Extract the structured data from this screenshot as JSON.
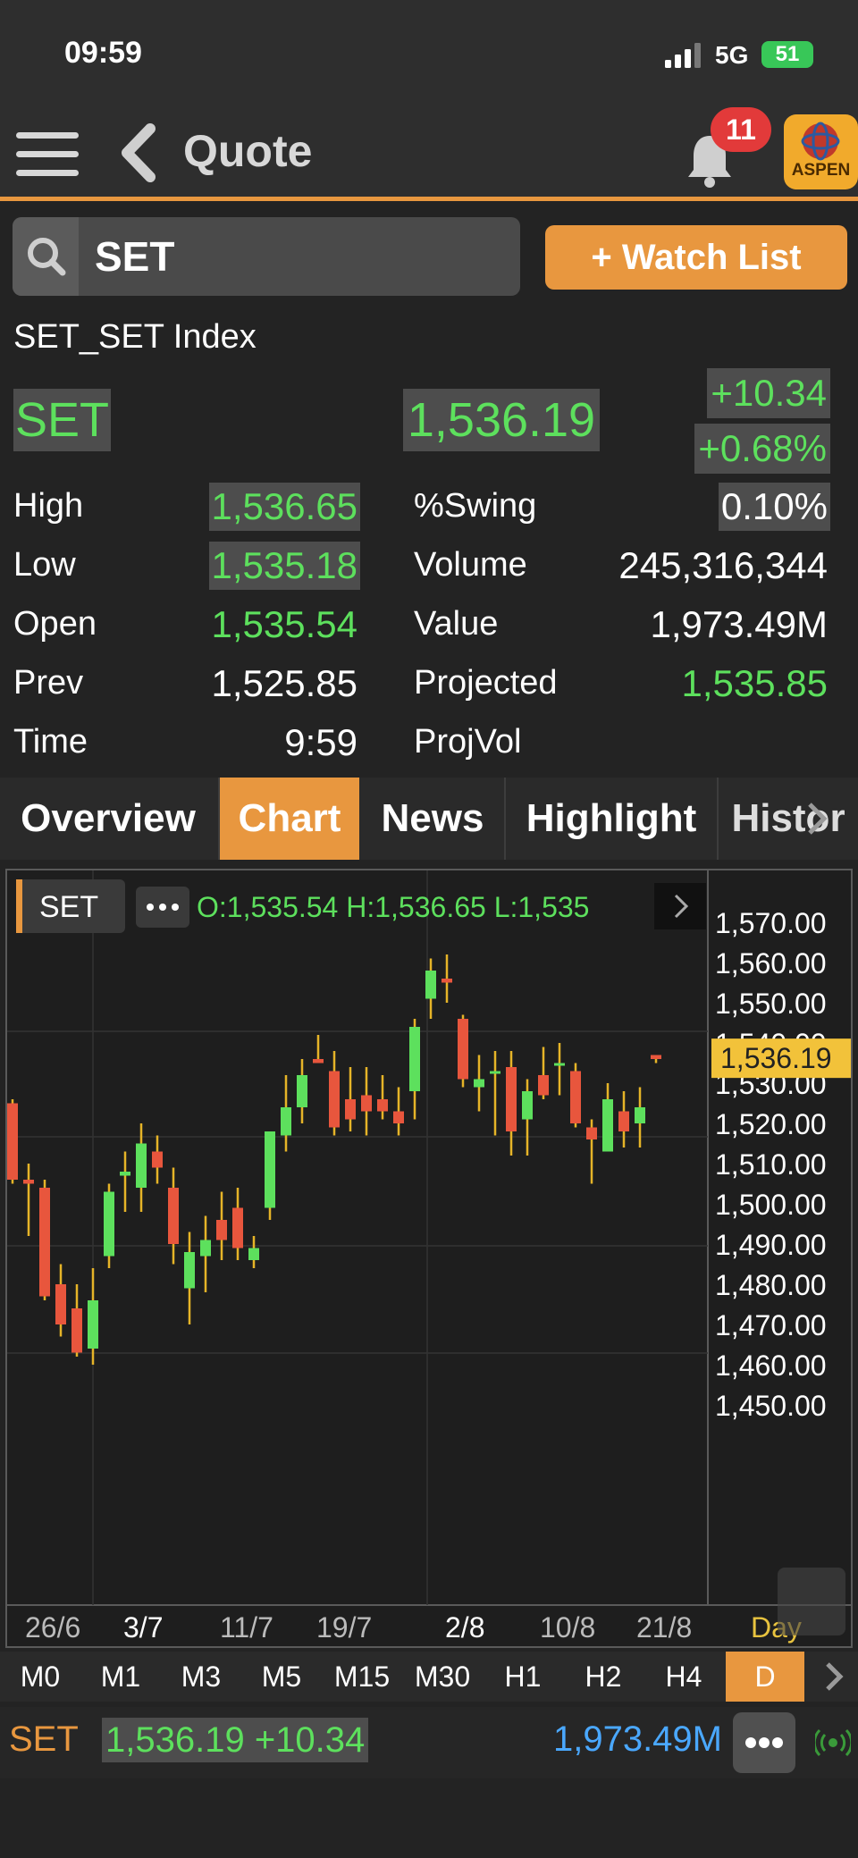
{
  "status": {
    "time": "09:59",
    "network": "5G",
    "battery": "51"
  },
  "header": {
    "title": "Quote",
    "notifications": "11",
    "brand": "ASPEN"
  },
  "search": {
    "value": "SET",
    "watch_label": "+ Watch List"
  },
  "quote": {
    "name": "SET_SET Index",
    "symbol": "SET",
    "last": "1,536.19",
    "change": "+10.34",
    "change_pct": "+0.68%",
    "high_label": "High",
    "high": "1,536.65",
    "low_label": "Low",
    "low": "1,535.18",
    "open_label": "Open",
    "open": "1,535.54",
    "prev_label": "Prev",
    "prev": "1,525.85",
    "time_label": "Time",
    "time": "9:59",
    "swing_label": "%Swing",
    "swing": "0.10%",
    "volume_label": "Volume",
    "volume": "245,316,344",
    "value_label": "Value",
    "value": "1,973.49M",
    "projected_label": "Projected",
    "projected": "1,535.85",
    "projvol_label": "ProjVol",
    "projvol": ""
  },
  "tabs": [
    "Overview",
    "Chart",
    "News",
    "Highlight",
    "Histor"
  ],
  "active_tab": "Chart",
  "chart_header": {
    "symbol": "SET",
    "ohlc": "O:1,535.54  H:1,536.65  L:1,535"
  },
  "timeframes": [
    "M0",
    "M1",
    "M3",
    "M5",
    "M15",
    "M30",
    "H1",
    "H2",
    "H4",
    "D"
  ],
  "active_timeframe": "D",
  "bottom": {
    "symbol": "SET",
    "price_change": "1,536.19 +10.34",
    "value": "1,973.49M"
  },
  "colors": {
    "accent": "#e8973f",
    "up": "#5de05d",
    "down": "#e8563d",
    "value_blue": "#4aa8ff"
  },
  "chart_data": {
    "type": "candlestick",
    "ylim": [
      1445,
      1575
    ],
    "y_ticks": [
      "1,570.00",
      "1,560.00",
      "1,550.00",
      "1,540.00",
      "1,530.00",
      "1,520.00",
      "1,510.00",
      "1,500.00",
      "1,490.00",
      "1,480.00",
      "1,470.00",
      "1,460.00",
      "1,450.00"
    ],
    "x_ticks": [
      "26/6",
      "3/7",
      "11/7",
      "19/7",
      "2/8",
      "10/8",
      "21/8"
    ],
    "period_label": "Day",
    "last_price_label": "1,536.19",
    "last_price": 1536.19,
    "candles": [
      {
        "o": 1525,
        "h": 1526,
        "l": 1505,
        "c": 1506
      },
      {
        "o": 1506,
        "h": 1510,
        "l": 1492,
        "c": 1505
      },
      {
        "o": 1504,
        "h": 1506,
        "l": 1476,
        "c": 1477
      },
      {
        "o": 1480,
        "h": 1485,
        "l": 1467,
        "c": 1470
      },
      {
        "o": 1474,
        "h": 1480,
        "l": 1462,
        "c": 1463
      },
      {
        "o": 1464,
        "h": 1484,
        "l": 1460,
        "c": 1476
      },
      {
        "o": 1487,
        "h": 1505,
        "l": 1484,
        "c": 1503
      },
      {
        "o": 1507,
        "h": 1513,
        "l": 1498,
        "c": 1508
      },
      {
        "o": 1504,
        "h": 1520,
        "l": 1498,
        "c": 1515
      },
      {
        "o": 1513,
        "h": 1517,
        "l": 1505,
        "c": 1509
      },
      {
        "o": 1504,
        "h": 1509,
        "l": 1485,
        "c": 1490
      },
      {
        "o": 1479,
        "h": 1493,
        "l": 1470,
        "c": 1488
      },
      {
        "o": 1487,
        "h": 1497,
        "l": 1478,
        "c": 1491
      },
      {
        "o": 1496,
        "h": 1503,
        "l": 1486,
        "c": 1491
      },
      {
        "o": 1499,
        "h": 1504,
        "l": 1486,
        "c": 1489
      },
      {
        "o": 1486,
        "h": 1492,
        "l": 1484,
        "c": 1489
      },
      {
        "o": 1499,
        "h": 1518,
        "l": 1496,
        "c": 1518
      },
      {
        "o": 1517,
        "h": 1532,
        "l": 1513,
        "c": 1524
      },
      {
        "o": 1524,
        "h": 1536,
        "l": 1520,
        "c": 1532
      },
      {
        "o": 1536,
        "h": 1542,
        "l": 1535,
        "c": 1535
      },
      {
        "o": 1533,
        "h": 1538,
        "l": 1517,
        "c": 1519
      },
      {
        "o": 1526,
        "h": 1534,
        "l": 1518,
        "c": 1521
      },
      {
        "o": 1527,
        "h": 1534,
        "l": 1517,
        "c": 1523
      },
      {
        "o": 1526,
        "h": 1532,
        "l": 1521,
        "c": 1523
      },
      {
        "o": 1523,
        "h": 1529,
        "l": 1517,
        "c": 1520
      },
      {
        "o": 1528,
        "h": 1546,
        "l": 1521,
        "c": 1544
      },
      {
        "o": 1551,
        "h": 1561,
        "l": 1546,
        "c": 1558
      },
      {
        "o": 1556,
        "h": 1562,
        "l": 1550,
        "c": 1555
      },
      {
        "o": 1546,
        "h": 1547,
        "l": 1529,
        "c": 1531
      },
      {
        "o": 1529,
        "h": 1537,
        "l": 1523,
        "c": 1531
      },
      {
        "o": 1533,
        "h": 1538,
        "l": 1517,
        "c": 1533
      },
      {
        "o": 1534,
        "h": 1538,
        "l": 1512,
        "c": 1518
      },
      {
        "o": 1521,
        "h": 1531,
        "l": 1512,
        "c": 1528
      },
      {
        "o": 1532,
        "h": 1539,
        "l": 1526,
        "c": 1527
      },
      {
        "o": 1535,
        "h": 1540,
        "l": 1527,
        "c": 1535
      },
      {
        "o": 1533,
        "h": 1535,
        "l": 1519,
        "c": 1520
      },
      {
        "o": 1519,
        "h": 1521,
        "l": 1505,
        "c": 1516
      },
      {
        "o": 1513,
        "h": 1530,
        "l": 1513,
        "c": 1526
      },
      {
        "o": 1523,
        "h": 1528,
        "l": 1514,
        "c": 1518
      },
      {
        "o": 1520,
        "h": 1529,
        "l": 1514,
        "c": 1524
      },
      {
        "o": 1537,
        "h": 1537,
        "l": 1535,
        "c": 1536
      }
    ]
  }
}
